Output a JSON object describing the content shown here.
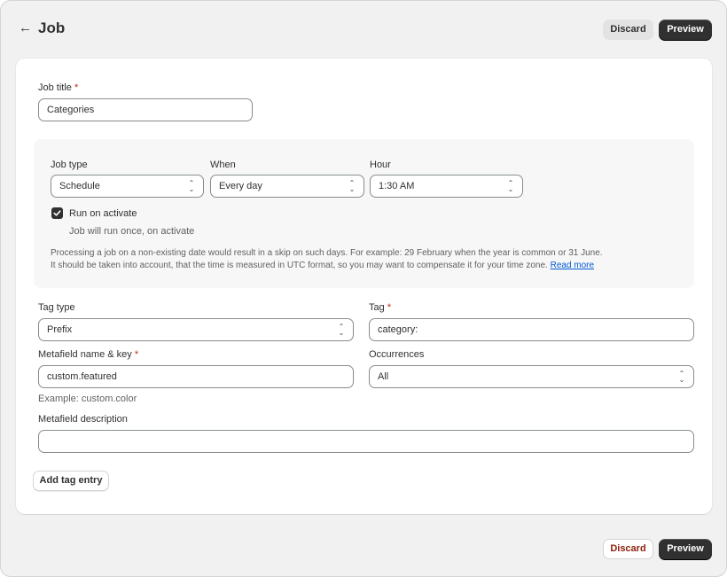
{
  "header": {
    "back_icon": "←",
    "title": "Job",
    "discard_label": "Discard",
    "preview_label": "Preview"
  },
  "form": {
    "job_title": {
      "label": "Job title",
      "required_mark": "*",
      "value": "Categories"
    },
    "job_type": {
      "label": "Job type",
      "value": "Schedule"
    },
    "when": {
      "label": "When",
      "value": "Every day"
    },
    "hour": {
      "label": "Hour",
      "value": "1:30 AM"
    },
    "run_on_activate": {
      "label": "Run on activate",
      "checked": true,
      "help": "Job will run once, on activate"
    },
    "note": {
      "line1": "Processing a job on a non-existing date would result in a skip on such days. For example: 29 February when the year is common or 31 June.",
      "line2": "It should be taken into account, that the time is measured in UTC format, so you may want to compensate it for your time zone.",
      "link": "Read more"
    },
    "tag_type": {
      "label": "Tag type",
      "value": "Prefix"
    },
    "tag": {
      "label": "Tag",
      "required_mark": "*",
      "value": "category:"
    },
    "metafield_key": {
      "label": "Metafield name & key",
      "required_mark": "*",
      "value": "custom.featured",
      "help": "Example: custom.color"
    },
    "occurrences": {
      "label": "Occurrences",
      "value": "All"
    },
    "metafield_description": {
      "label": "Metafield description",
      "value": ""
    },
    "add_tag_label": "Add tag entry"
  },
  "footer": {
    "discard_label": "Discard",
    "preview_label": "Preview"
  },
  "colors": {
    "primary_button": "#303030",
    "link": "#005bd3",
    "required": "#c5280c",
    "discard_text": "#8e1f0b"
  }
}
